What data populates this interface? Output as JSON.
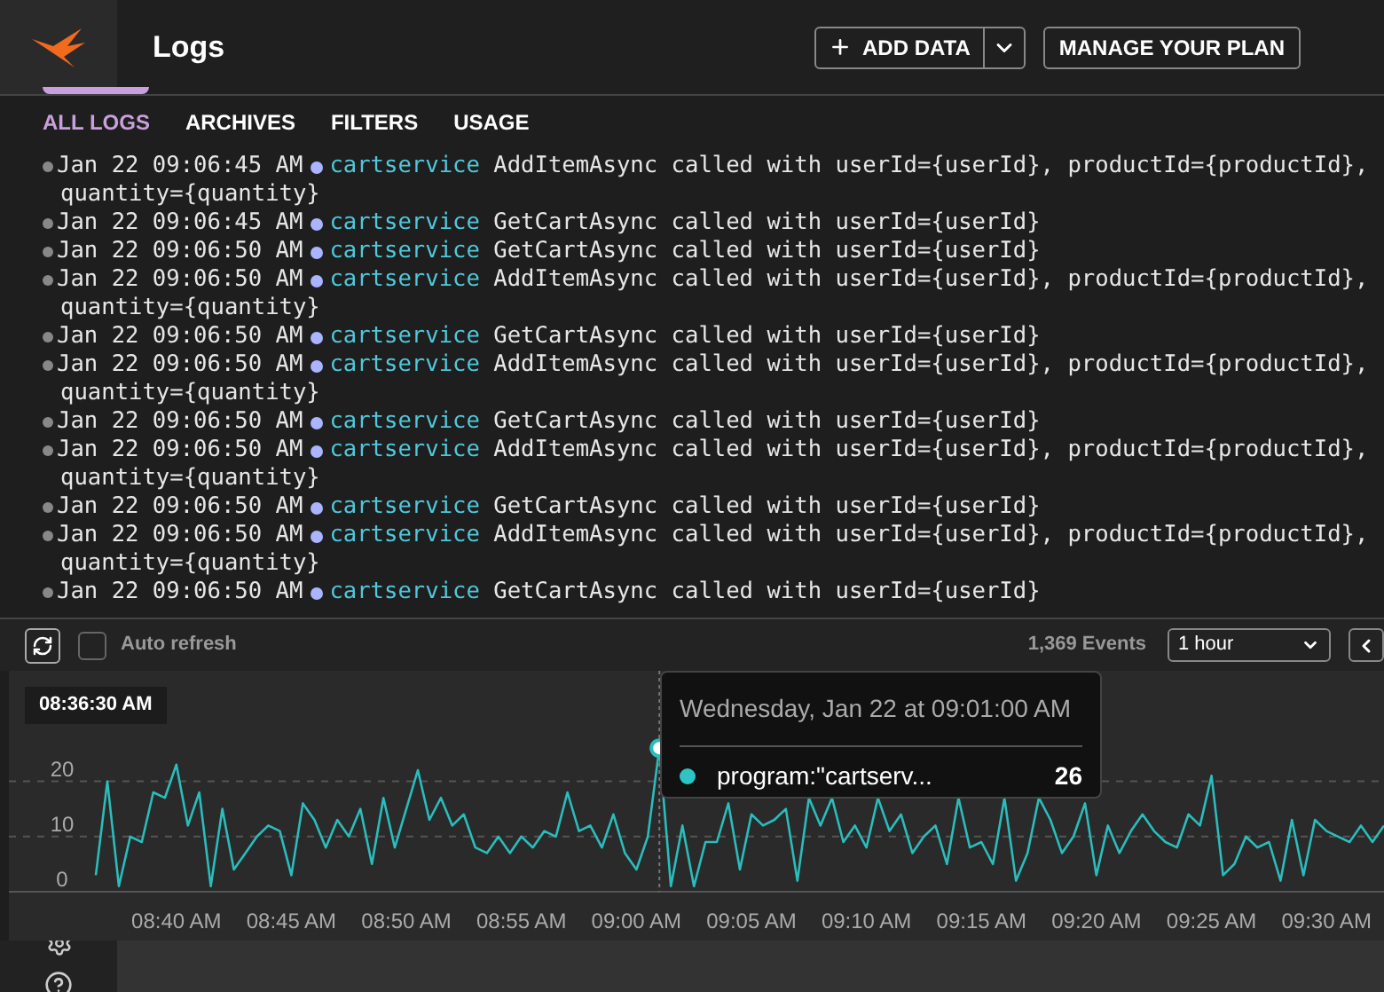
{
  "header": {
    "title": "Logs",
    "add_button": "ADD DATA",
    "plan_button": "MANAGE YOUR PLAN"
  },
  "tabs": [
    {
      "label": "ALL LOGS",
      "selected": true
    },
    {
      "label": "ARCHIVES",
      "selected": false
    },
    {
      "label": "FILTERS",
      "selected": false
    },
    {
      "label": "USAGE",
      "selected": false
    }
  ],
  "logs": [
    {
      "time": "Jan 22 09:06:45 AM",
      "service": "cartservice",
      "message": "AddItemAsync called with userId={userId}, productId={productId},",
      "continuation": "quantity={quantity}"
    },
    {
      "time": "Jan 22 09:06:45 AM",
      "service": "cartservice",
      "message": "GetCartAsync called with userId={userId}"
    },
    {
      "time": "Jan 22 09:06:50 AM",
      "service": "cartservice",
      "message": "GetCartAsync called with userId={userId}"
    },
    {
      "time": "Jan 22 09:06:50 AM",
      "service": "cartservice",
      "message": "AddItemAsync called with userId={userId}, productId={productId},",
      "continuation": "quantity={quantity}"
    },
    {
      "time": "Jan 22 09:06:50 AM",
      "service": "cartservice",
      "message": "GetCartAsync called with userId={userId}"
    },
    {
      "time": "Jan 22 09:06:50 AM",
      "service": "cartservice",
      "message": "AddItemAsync called with userId={userId}, productId={productId},",
      "continuation": "quantity={quantity}"
    },
    {
      "time": "Jan 22 09:06:50 AM",
      "service": "cartservice",
      "message": "GetCartAsync called with userId={userId}"
    },
    {
      "time": "Jan 22 09:06:50 AM",
      "service": "cartservice",
      "message": "AddItemAsync called with userId={userId}, productId={productId},",
      "continuation": "quantity={quantity}"
    },
    {
      "time": "Jan 22 09:06:50 AM",
      "service": "cartservice",
      "message": "GetCartAsync called with userId={userId}"
    },
    {
      "time": "Jan 22 09:06:50 AM",
      "service": "cartservice",
      "message": "AddItemAsync called with userId={userId}, productId={productId},",
      "continuation": "quantity={quantity}"
    },
    {
      "time": "Jan 22 09:06:50 AM",
      "service": "cartservice",
      "message": "GetCartAsync called with userId={userId}"
    }
  ],
  "toolbar": {
    "auto_refresh": {
      "label": "Auto refresh",
      "checked": false
    },
    "events": "1,369 Events",
    "range": "1 hour"
  },
  "chart": {
    "start_label": "08:36:30 AM",
    "tooltip": {
      "title": "Wednesday, Jan 22 at 09:01:00 AM",
      "series": "program:\"cartserv...",
      "color": "#2ec4c4",
      "value": "26"
    },
    "chart_data": {
      "type": "line",
      "ylim": [
        0,
        40
      ],
      "yticks": [
        0,
        10,
        20
      ],
      "categories": [
        null,
        null,
        null,
        null,
        null,
        null,
        null,
        "08:40 AM",
        null,
        null,
        null,
        null,
        null,
        null,
        null,
        null,
        null,
        "08:45 AM",
        null,
        null,
        null,
        null,
        null,
        null,
        null,
        null,
        null,
        "08:50 AM",
        null,
        null,
        null,
        null,
        null,
        null,
        null,
        null,
        null,
        "08:55 AM",
        null,
        null,
        null,
        null,
        null,
        null,
        null,
        null,
        null,
        "09:00 AM",
        null,
        null,
        null,
        null,
        null,
        null,
        null,
        null,
        null,
        "09:05 AM",
        null,
        null,
        null,
        null,
        null,
        null,
        null,
        null,
        null,
        "09:10 AM",
        null,
        null,
        null,
        null,
        null,
        null,
        null,
        null,
        null,
        "09:15 AM",
        null,
        null,
        null,
        null,
        null,
        null,
        null,
        null,
        null,
        "09:20 AM",
        null,
        null,
        null,
        null,
        null,
        null,
        null,
        null,
        null,
        "09:25 AM",
        null,
        null,
        null,
        null,
        null,
        null,
        null,
        null,
        null,
        "09:30 AM",
        null,
        null,
        null,
        null,
        null
      ],
      "series": [
        {
          "color": "#2bbcbc",
          "values": [
            3,
            20,
            1,
            10,
            9,
            18,
            17,
            23,
            12,
            18,
            1,
            15,
            4,
            7,
            10,
            12,
            11,
            3,
            16,
            13,
            8,
            13,
            10,
            15,
            5,
            17,
            8,
            15,
            22,
            13,
            17,
            12,
            14,
            8,
            7,
            10,
            7,
            10,
            8,
            11,
            10,
            18,
            11,
            12,
            8,
            14,
            7,
            4,
            10,
            26,
            1,
            12,
            1,
            9,
            9,
            16,
            4,
            14,
            12,
            13,
            15,
            2,
            17,
            12,
            17,
            9,
            12,
            8,
            17,
            11,
            14,
            7,
            10,
            12,
            5,
            17,
            8,
            9,
            5,
            17,
            2,
            7,
            17,
            13,
            7,
            10,
            16,
            3,
            12,
            7,
            11,
            14,
            11,
            9,
            8,
            14,
            12,
            21,
            3,
            5,
            10,
            8,
            9,
            2,
            13,
            3,
            13,
            11,
            10,
            9,
            12,
            9,
            12
          ]
        }
      ]
    }
  }
}
